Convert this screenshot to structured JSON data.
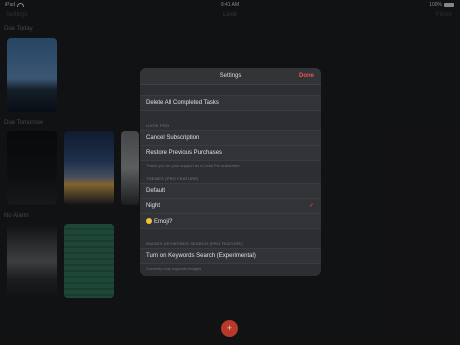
{
  "status_bar": {
    "carrier": "iPad",
    "time": "9:41 AM",
    "battery": "100%"
  },
  "nav": {
    "left": "Settings",
    "title": "Livok",
    "right": "Finish"
  },
  "sections": [
    {
      "title": "Due Today"
    },
    {
      "title": "Due Tomorrow"
    },
    {
      "title": "No Alarm"
    }
  ],
  "settings": {
    "title": "Settings",
    "done_label": "Done",
    "delete_completed": "Delete All Completed Tasks",
    "livok_pro_label": "LIVOK PRO",
    "cancel_subscription": "Cancel Subscription",
    "restore_purchases": "Restore Previous Purchases",
    "restore_note": "Thank you for your support as a Livok Pro subscriber.",
    "themes_label": "THEMES (PRO FEATURE)",
    "theme_options": [
      "Default",
      "Night",
      "Emoji"
    ],
    "selected_theme": "Night",
    "search_label": "IMAGES KEYWORDS SEARCH (PRO FEATURE)",
    "keyword_search": "Turn on Keywords Search (Experimental)",
    "search_note": "Currently only supports images"
  },
  "fab_label": "+",
  "colors": {
    "accent": "#e0584a",
    "fab": "#b8392b",
    "background": "#1b1c1e",
    "modal": "#2d2e31"
  }
}
